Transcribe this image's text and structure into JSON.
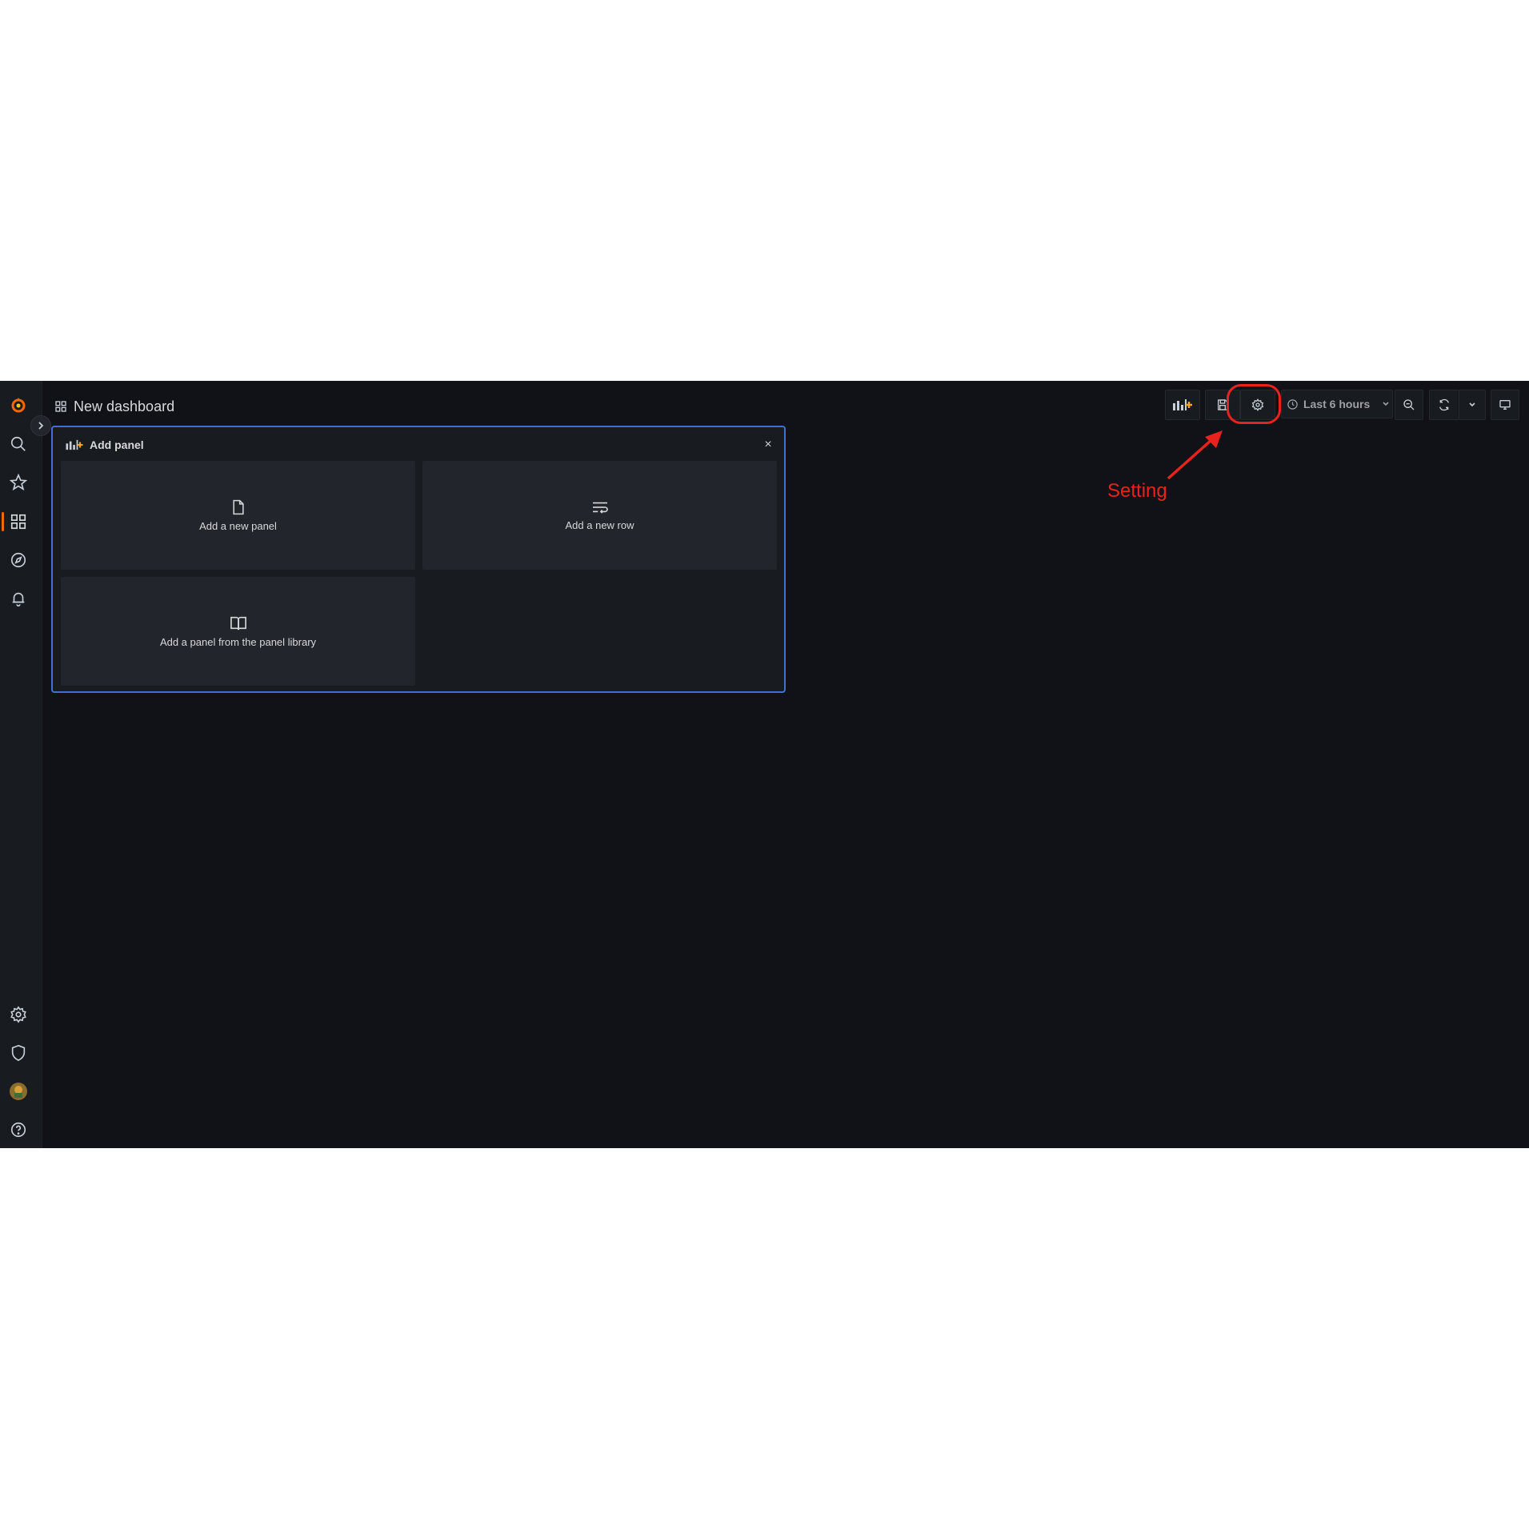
{
  "app": {
    "title": "New dashboard",
    "accent_color": "#f46800",
    "panel_border_color": "#3d71d9"
  },
  "sidebar": {
    "items": [
      {
        "name": "grafana-logo-icon"
      },
      {
        "name": "search-icon"
      },
      {
        "name": "star-icon"
      },
      {
        "name": "dashboards-icon",
        "active": true
      },
      {
        "name": "explore-compass-icon"
      },
      {
        "name": "alerting-bell-icon"
      },
      {
        "name": "gear-icon"
      },
      {
        "name": "shield-icon"
      },
      {
        "name": "avatar"
      },
      {
        "name": "help-icon"
      }
    ]
  },
  "toolbar": {
    "time_range_label": "Last 6 hours",
    "buttons": [
      "add-panel-icon",
      "save-icon",
      "gear-icon",
      "zoom-out-icon",
      "refresh-icon",
      "chevron-down-icon",
      "tv-mode-icon"
    ]
  },
  "add_panel": {
    "header": "Add panel",
    "close_symbol": "×",
    "options": [
      {
        "label": "Add a new panel",
        "icon": "file-icon"
      },
      {
        "label": "Add a new row",
        "icon": "rows-icon"
      },
      {
        "label": "Add a panel from the panel library",
        "icon": "book-icon"
      }
    ]
  },
  "annotation": {
    "label": "Setting",
    "color": "#e8231d"
  }
}
